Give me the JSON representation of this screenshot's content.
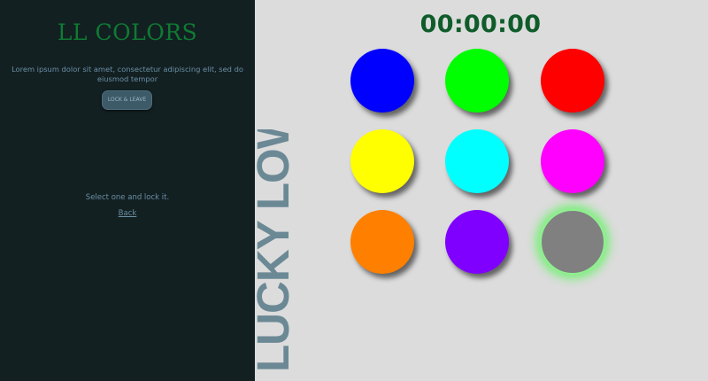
{
  "sidebar": {
    "brand": "LL COLORS",
    "description": "Lorem ipsum dolor sit amet, consectetur adipiscing elit, sed do eiusmod tempor",
    "lock_button": "LOCK & LEAVE",
    "hint": "Select one and lock it.",
    "back": "Back"
  },
  "vertical_title": "LUCKY LOWS",
  "timer": "00:00:00",
  "colors": [
    {
      "name": "blue",
      "hex": "#0000ff"
    },
    {
      "name": "green",
      "hex": "#00ff00"
    },
    {
      "name": "red",
      "hex": "#ff0000"
    },
    {
      "name": "yellow",
      "hex": "#ffff00"
    },
    {
      "name": "cyan",
      "hex": "#00ffff"
    },
    {
      "name": "magenta",
      "hex": "#ff00ff"
    },
    {
      "name": "orange",
      "hex": "#ff8000"
    },
    {
      "name": "purple",
      "hex": "#8000ff"
    },
    {
      "name": "gray",
      "hex": "#808080",
      "selected": true
    }
  ]
}
